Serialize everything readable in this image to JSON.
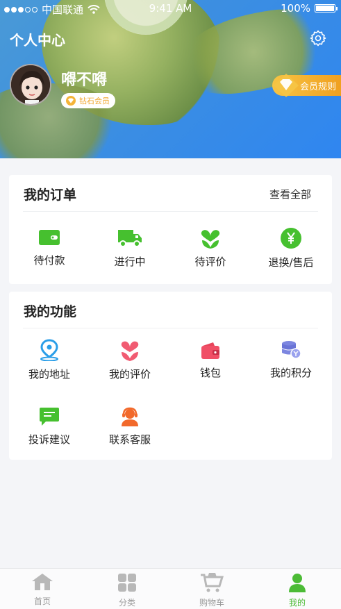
{
  "status_bar": {
    "carrier": "中国联通",
    "time": "9:41 AM",
    "battery": "100%"
  },
  "header": {
    "title": "个人中心",
    "username": "嘚不嘚",
    "level": "钻石会员",
    "rules": "会员规则"
  },
  "orders": {
    "title": "我的订单",
    "view_all": "查看全部",
    "items": [
      {
        "label": "待付款",
        "icon": "wallet-icon"
      },
      {
        "label": "进行中",
        "icon": "truck-icon"
      },
      {
        "label": "待评价",
        "icon": "heart-icon"
      },
      {
        "label": "退换/售后",
        "icon": "yen-icon"
      }
    ]
  },
  "functions": {
    "title": "我的功能",
    "items": [
      {
        "label": "我的地址",
        "icon": "location-icon"
      },
      {
        "label": "我的评价",
        "icon": "flower-icon"
      },
      {
        "label": "钱包",
        "icon": "purse-icon"
      },
      {
        "label": "我的积分",
        "icon": "coins-icon"
      },
      {
        "label": "投诉建议",
        "icon": "message-icon"
      },
      {
        "label": "联系客服",
        "icon": "customer-service-icon"
      }
    ]
  },
  "tabbar": [
    {
      "label": "首页",
      "icon": "home-icon"
    },
    {
      "label": "分类",
      "icon": "category-icon"
    },
    {
      "label": "购物车",
      "icon": "cart-icon"
    },
    {
      "label": "我的",
      "icon": "profile-icon",
      "active": true
    }
  ],
  "colors": {
    "accent_green": "#4cbb36",
    "header_blue": "#2f86f0",
    "gold": "#f0a020"
  }
}
